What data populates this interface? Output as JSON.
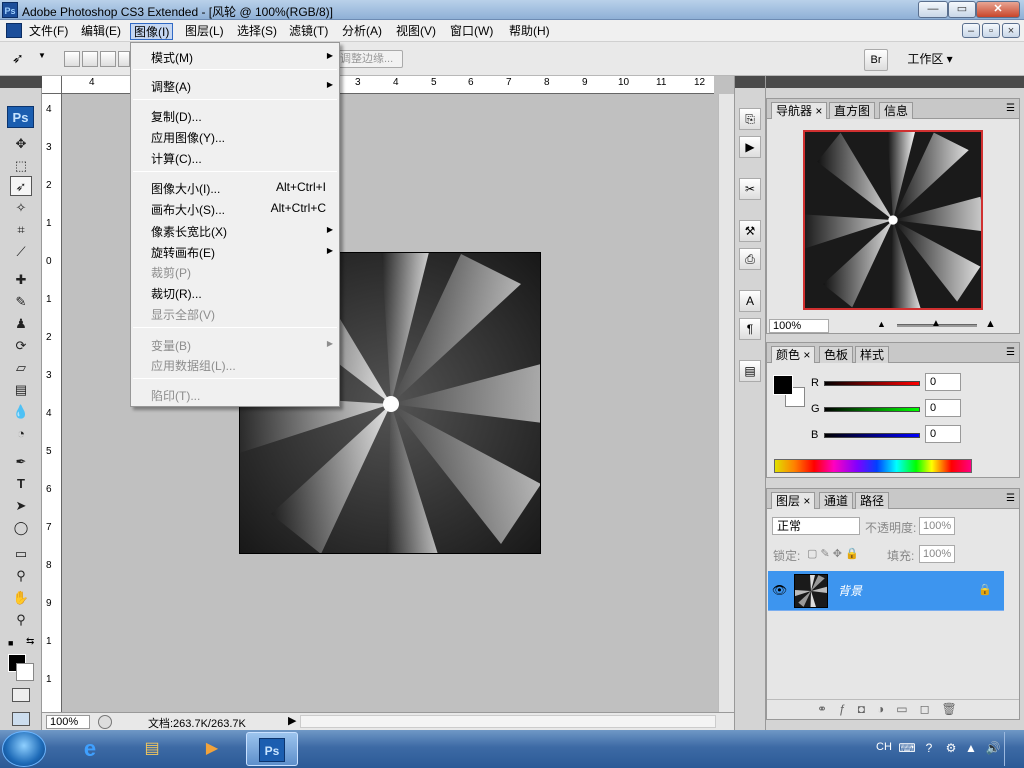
{
  "window": {
    "title": "Adobe Photoshop CS3 Extended - [风轮 @ 100%(RGB/8)]",
    "app_icon_text": "Ps",
    "minimize": "—",
    "maximize": "▭",
    "close": "✕"
  },
  "menubar": {
    "items": [
      "文件(F)",
      "编辑(E)",
      "图像(I)",
      "图层(L)",
      "选择(S)",
      "滤镜(T)",
      "分析(A)",
      "视图(V)",
      "窗口(W)",
      "帮助(H)"
    ],
    "active": "图像(I)"
  },
  "options_bar": {
    "refine_edge": "调整边缘...",
    "workspace": "工作区 ▾",
    "bridge": "Br"
  },
  "image_menu": {
    "mode": "模式(M)",
    "adjust": "调整(A)",
    "duplicate": "复制(D)...",
    "apply_image": "应用图像(Y)...",
    "calculations": "计算(C)...",
    "image_size": "图像大小(I)...",
    "image_size_shortcut": "Alt+Ctrl+I",
    "canvas_size": "画布大小(S)...",
    "canvas_size_shortcut": "Alt+Ctrl+C",
    "pixel_aspect": "像素长宽比(X)",
    "rotate_canvas": "旋转画布(E)",
    "crop": "裁剪(P)",
    "trim": "裁切(R)...",
    "reveal_all": "显示全部(V)",
    "variables": "变量(B)",
    "apply_data_set": "应用数据组(L)...",
    "trap": "陷印(T)..."
  },
  "rulers": {
    "horizontal": [
      "4",
      "4",
      "3",
      "4",
      "5",
      "6",
      "7",
      "8",
      "9",
      "10",
      "11",
      "12"
    ],
    "vertical": [
      "4",
      "3",
      "2",
      "1",
      "0",
      "1",
      "2",
      "3",
      "4",
      "5",
      "6",
      "7",
      "8",
      "9",
      "1",
      "1"
    ]
  },
  "status_bar": {
    "zoom": "100%",
    "doc_size": "文档:263.7K/263.7K"
  },
  "navigator_panel": {
    "tabs": [
      "导航器",
      "直方图",
      "信息"
    ],
    "zoom": "100%"
  },
  "color_panel": {
    "tabs": [
      "颜色",
      "色板",
      "样式"
    ],
    "r_label": "R",
    "g_label": "G",
    "b_label": "B",
    "r_value": "0",
    "g_value": "0",
    "b_value": "0"
  },
  "layers_panel": {
    "tabs": [
      "图层",
      "通道",
      "路径"
    ],
    "blend_mode": "正常",
    "opacity_label": "不透明度:",
    "opacity": "100%",
    "lock_label": "锁定:",
    "fill_label": "填充:",
    "fill": "100%",
    "layer_name": "背景"
  },
  "taskbar": {
    "tray_lang": "CH"
  },
  "colors": {
    "foreground": "#000000",
    "background": "#ffffff",
    "selected_layer": "#3d95ef"
  }
}
